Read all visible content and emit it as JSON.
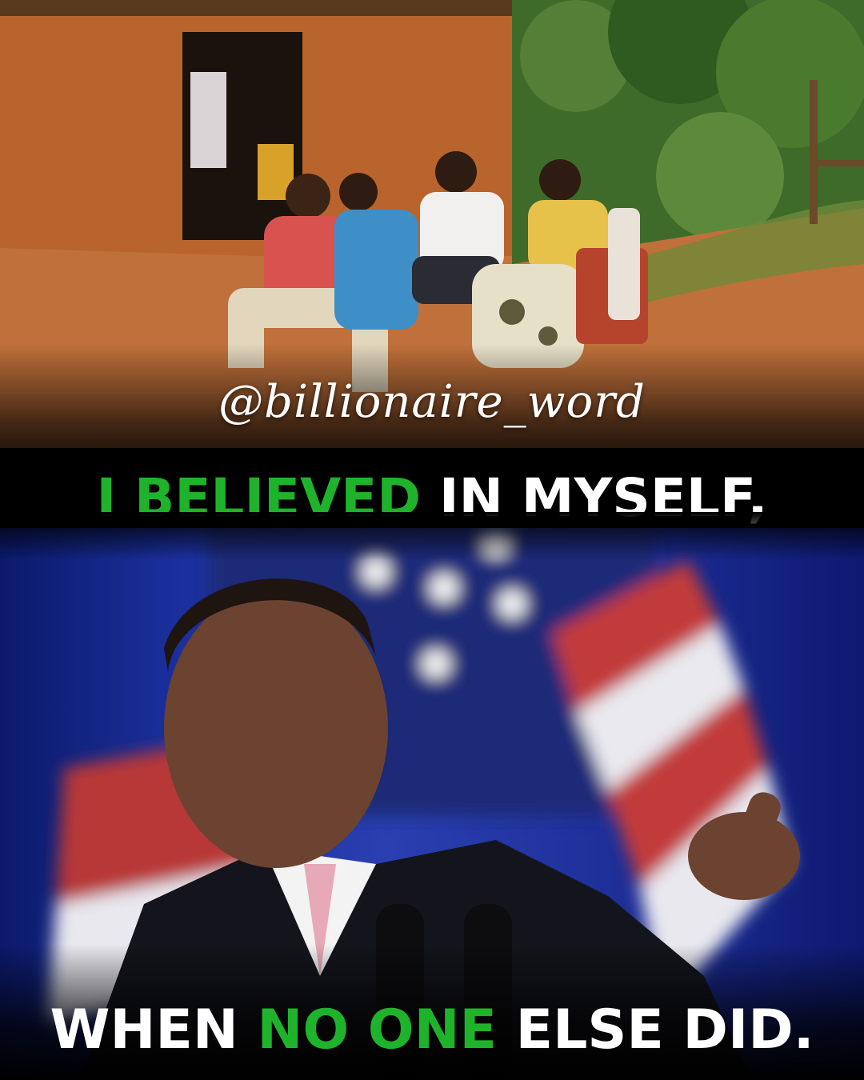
{
  "watermark": "@billionaire_word",
  "headline_top": {
    "highlight": "I BELIEVED",
    "rest": " IN MYSELF,"
  },
  "headline_bottom": {
    "lead": "WHEN ",
    "highlight": "NO ONE",
    "rest": " ELSE DID."
  },
  "colors": {
    "accent_green": "#1fb32c",
    "text_white": "#ffffff",
    "background": "#000000"
  }
}
